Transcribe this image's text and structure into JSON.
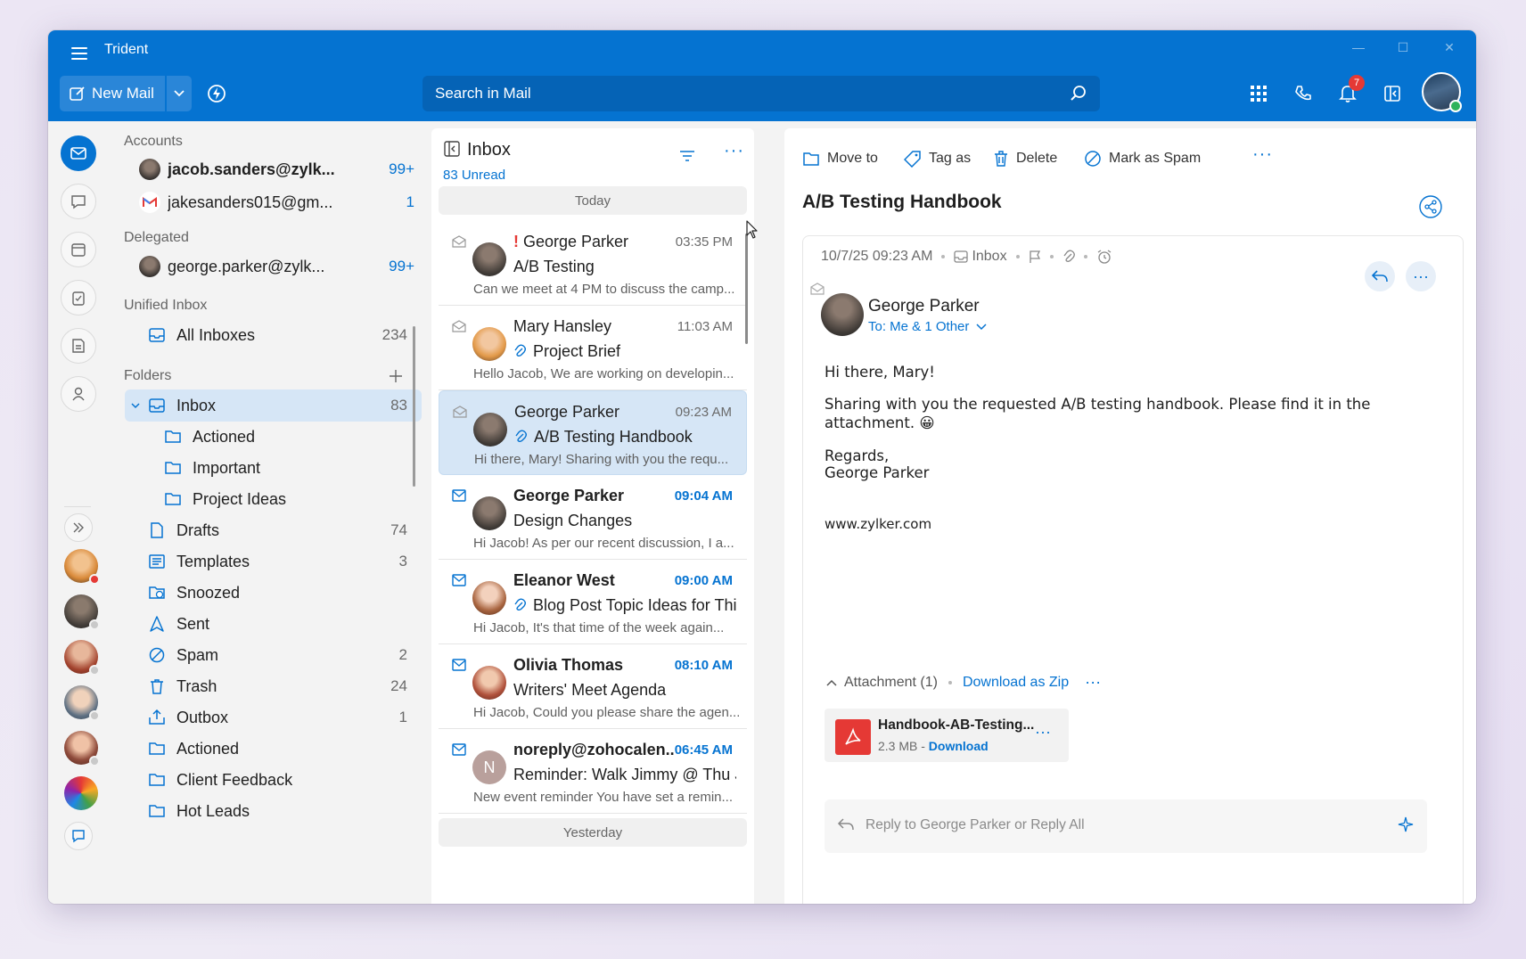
{
  "app": {
    "title": "Trident"
  },
  "toolbar": {
    "new_mail": "New Mail",
    "search_placeholder": "Search in Mail",
    "notification_count": "7"
  },
  "accounts": {
    "label": "Accounts",
    "items": [
      {
        "name": "jacob.sanders@zylk...",
        "count": "99+"
      },
      {
        "name": "jakesanders015@gm...",
        "count": "1"
      }
    ]
  },
  "delegated": {
    "label": "Delegated",
    "items": [
      {
        "name": "george.parker@zylk...",
        "count": "99+"
      }
    ]
  },
  "unified": {
    "label": "Unified Inbox",
    "all_inboxes": {
      "label": "All Inboxes",
      "count": "234"
    }
  },
  "folders": {
    "label": "Folders",
    "items": [
      {
        "label": "Inbox",
        "count": "83",
        "icon": "inbox-icon"
      },
      {
        "label": "Actioned",
        "count": "",
        "icon": "folder-icon"
      },
      {
        "label": "Important",
        "count": "",
        "icon": "folder-icon"
      },
      {
        "label": "Project Ideas",
        "count": "",
        "icon": "folder-icon"
      },
      {
        "label": "Drafts",
        "count": "74",
        "icon": "draft-icon"
      },
      {
        "label": "Templates",
        "count": "3",
        "icon": "template-icon"
      },
      {
        "label": "Snoozed",
        "count": "",
        "icon": "snooze-icon"
      },
      {
        "label": "Sent",
        "count": "",
        "icon": "sent-icon"
      },
      {
        "label": "Spam",
        "count": "2",
        "icon": "spam-icon"
      },
      {
        "label": "Trash",
        "count": "24",
        "icon": "trash-icon"
      },
      {
        "label": "Outbox",
        "count": "1",
        "icon": "outbox-icon"
      },
      {
        "label": "Actioned",
        "count": "",
        "icon": "folder-icon"
      },
      {
        "label": "Client Feedback",
        "count": "",
        "icon": "folder-icon"
      },
      {
        "label": "Hot Leads",
        "count": "",
        "icon": "folder-icon"
      }
    ]
  },
  "list": {
    "title": "Inbox",
    "unread": "83 Unread",
    "today": "Today",
    "yesterday": "Yesterday",
    "messages": [
      {
        "sender": "George Parker",
        "time": "03:35 PM",
        "subject": "A/B Testing",
        "preview": "Can we meet at 4 PM to discuss the camp...",
        "important": true,
        "attachment": false
      },
      {
        "sender": "Mary Hansley",
        "time": "11:03 AM",
        "subject": "Project Brief",
        "preview": "Hello Jacob, We are working on developin...",
        "important": false,
        "attachment": true
      },
      {
        "sender": "George Parker",
        "time": "09:23 AM",
        "subject": "A/B Testing Handbook",
        "preview": "Hi there, Mary! Sharing with you the requ...",
        "important": false,
        "attachment": true
      },
      {
        "sender": "George Parker",
        "time": "09:04 AM",
        "subject": "Design Changes",
        "preview": "Hi Jacob! As per our recent discussion, I a...",
        "important": false,
        "attachment": false
      },
      {
        "sender": "Eleanor West",
        "time": "09:00 AM",
        "subject": "Blog Post Topic Ideas for Thi...",
        "preview": "Hi Jacob, It's that time of the week again...",
        "important": false,
        "attachment": true
      },
      {
        "sender": "Olivia Thomas",
        "time": "08:10 AM",
        "subject": "Writers' Meet Agenda",
        "preview": "Hi Jacob, Could you please share the agen...",
        "important": false,
        "attachment": false
      },
      {
        "sender": "noreply@zohocalen...",
        "time": "06:45 AM",
        "subject": "Reminder: Walk Jimmy @ Thu J...",
        "preview": "New event reminder You have set a remin...",
        "important": false,
        "attachment": false,
        "initial": "N"
      }
    ]
  },
  "reader": {
    "actions": {
      "move_to": "Move to",
      "tag_as": "Tag as",
      "delete": "Delete",
      "mark_spam": "Mark as Spam"
    },
    "subject": "A/B Testing Handbook",
    "datetime": "10/7/25 09:23 AM",
    "folder": "Inbox",
    "sender": "George Parker",
    "to": "To: Me & 1 Other",
    "body": {
      "greeting": "Hi there, Mary!",
      "line1": "Sharing with you the requested A/B testing handbook. Please find it in the",
      "line2": "attachment. 😀",
      "regards": "Regards,",
      "signature": "George Parker",
      "website": "www.zylker.com"
    },
    "attachment_label": "Attachment (1)",
    "download_zip": "Download as Zip",
    "file": {
      "name": "Handbook-AB-Testing...",
      "size": "2.3 MB - ",
      "download": "Download"
    },
    "reply_placeholder": "Reply to George Parker or Reply All"
  },
  "colors": {
    "accent": "#0573d1",
    "selected": "#d6e6f6",
    "pdf": "#e53935"
  }
}
